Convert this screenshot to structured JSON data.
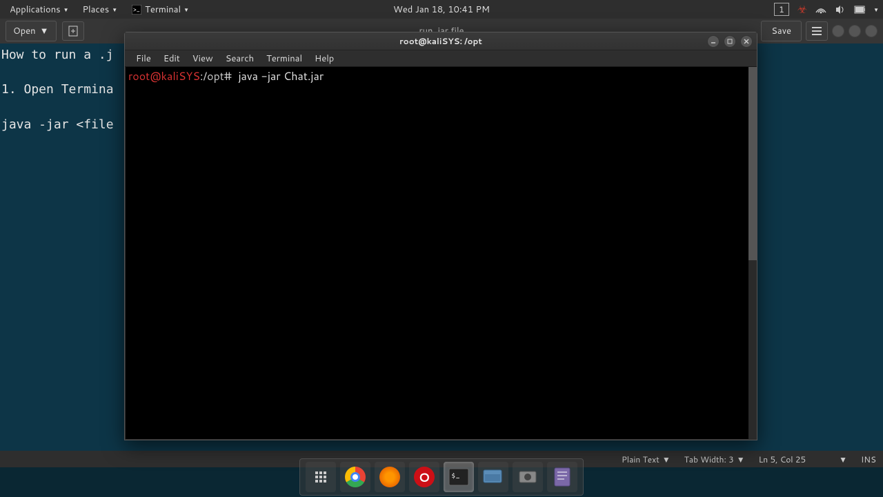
{
  "topPanel": {
    "applications": "Applications",
    "places": "Places",
    "terminal": "Terminal",
    "datetime": "Wed Jan 18, 10:41 PM",
    "workspace": "1"
  },
  "gedit": {
    "open": "Open",
    "title": "run .jar file",
    "save": "Save",
    "content": "How to run a .j\n\n1. Open Termina\n\njava -jar <file",
    "statusbar": {
      "plainText": "Plain Text",
      "tabWidth": "Tab Width: 3",
      "lnCol": "Ln 5, Col 25",
      "ins": "INS"
    }
  },
  "terminal": {
    "title": "root@kaliSYS: /opt",
    "menus": {
      "file": "File",
      "edit": "Edit",
      "view": "View",
      "search": "Search",
      "terminal": "Terminal",
      "help": "Help"
    },
    "prompt": {
      "user": "root@kaliSYS",
      "sep": ":",
      "path": "/opt",
      "sigil": "#"
    },
    "command": "java -jar Chat.jar"
  },
  "dock": {
    "items": [
      "apps-grid",
      "chrome",
      "firefox",
      "opera",
      "terminal",
      "files",
      "screenshot",
      "text-editor"
    ]
  }
}
